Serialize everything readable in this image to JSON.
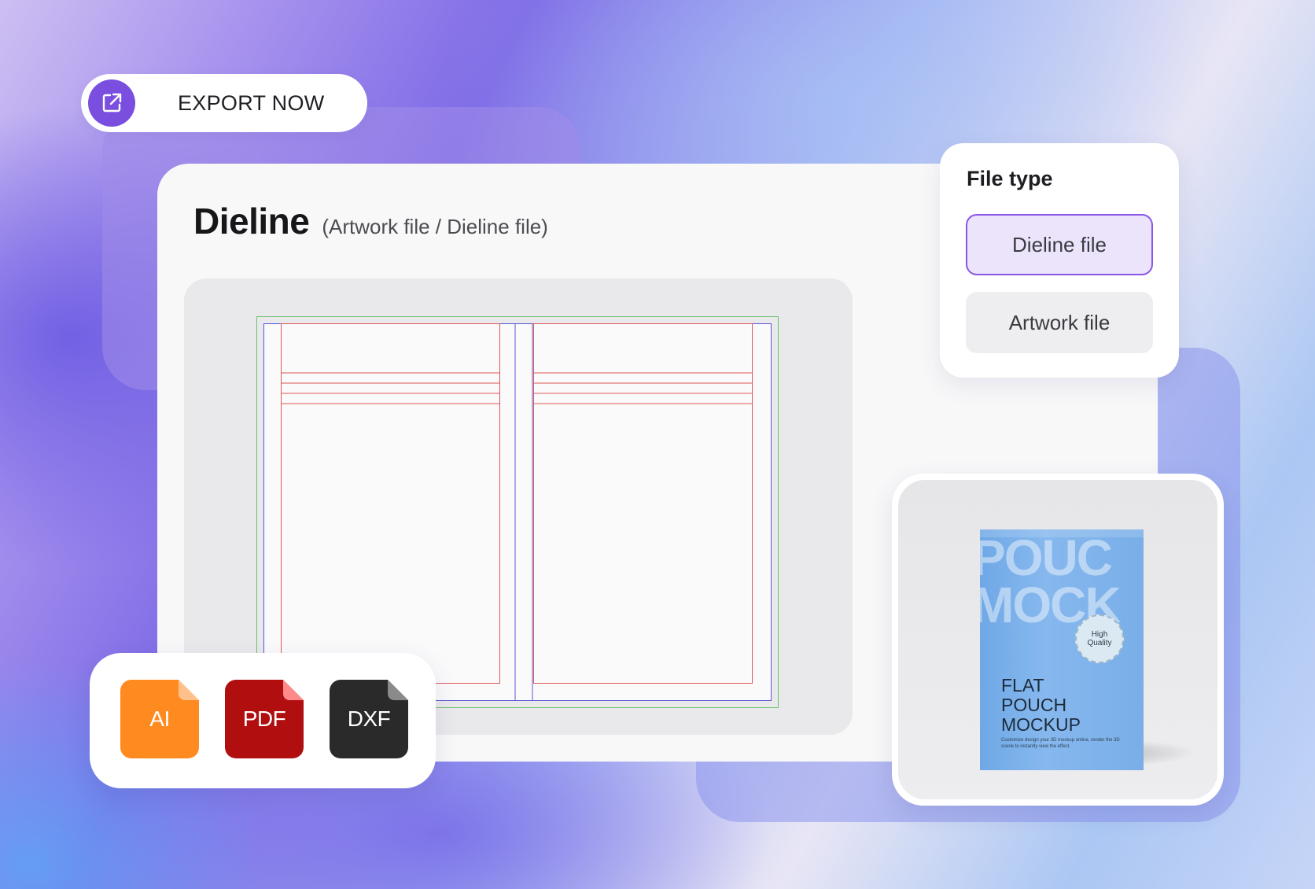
{
  "export": {
    "label": "EXPORT NOW",
    "icon": "external-link-icon"
  },
  "panel": {
    "title": "Dieline",
    "subtitle": "(Artwork file / Dieline file)"
  },
  "file_type": {
    "title": "File type",
    "options": [
      {
        "label": "Dieline file",
        "selected": true
      },
      {
        "label": "Artwork file",
        "selected": false
      }
    ]
  },
  "formats": [
    {
      "label": "AI",
      "color": "#ff8a1f"
    },
    {
      "label": "PDF",
      "color": "#b10f0f"
    },
    {
      "label": "DXF",
      "color": "#2a2a2a"
    }
  ],
  "mockup": {
    "big_text": "POUC\nMOCK",
    "badge": "High\nQuality",
    "title": "FLAT\nPOUCH\nMOCKUP",
    "description": "Customize design your 3D mockup online, render the 3D scene to instantly view the effect."
  },
  "colors": {
    "accent": "#7a4fe0",
    "dieline_red": "#e05757",
    "dieline_blue": "#5a55d6",
    "dieline_green": "#55b055"
  }
}
